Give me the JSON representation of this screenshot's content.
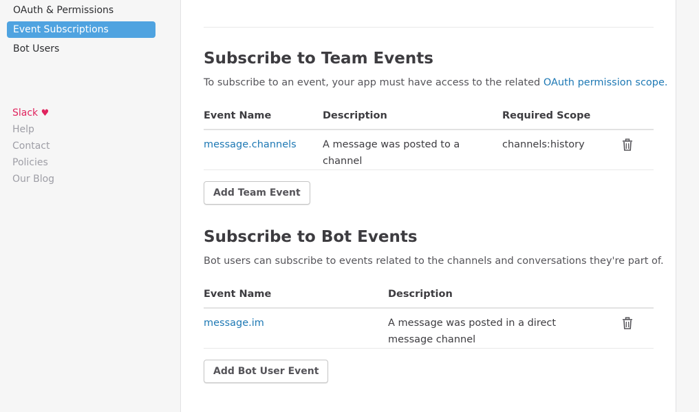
{
  "sidebar": {
    "items": [
      {
        "label": "OAuth & Permissions"
      },
      {
        "label": "Event Subscriptions"
      },
      {
        "label": "Bot Users"
      }
    ],
    "footer": {
      "slack": "Slack",
      "heart": "♥",
      "help": "Help",
      "contact": "Contact",
      "policies": "Policies",
      "blog": "Our Blog"
    }
  },
  "team_events": {
    "title": "Subscribe to Team Events",
    "description": "To subscribe to an event, your app must have access to the related",
    "link": "OAuth permission scope.",
    "columns": {
      "name": "Event Name",
      "description": "Description",
      "scope": "Required Scope"
    },
    "rows": [
      {
        "name": "message.channels",
        "description_line1": "A message was posted to a",
        "description_line2": "channel",
        "scope": "channels:history"
      }
    ],
    "add_button": "Add Team Event"
  },
  "bot_events": {
    "title": "Subscribe to Bot Events",
    "description": "Bot users can subscribe to events related to the channels and conversations they're part of.",
    "columns": {
      "name": "Event Name",
      "description": "Description"
    },
    "rows": [
      {
        "name": "message.im",
        "description_line1": "A message was posted in a direct",
        "description_line2": "message channel"
      }
    ],
    "add_button": "Add Bot User Event"
  },
  "colors": {
    "accent": "#4fa3e0",
    "link": "#1d78b4",
    "heart": "#e0245e"
  }
}
